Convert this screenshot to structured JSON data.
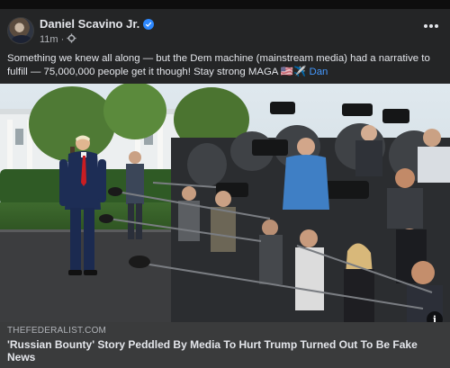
{
  "post": {
    "author": "Daniel Scavino Jr.",
    "time": "11m",
    "audience_icon": "gear-icon",
    "text": "Something we knew all along — but the Dem machine (mainstream media) had a narrative to fulfill — 75,000,000 people get it though! Stay strong MAGA 🇺🇸✈️ ",
    "signature": "Dan"
  },
  "link_preview": {
    "domain": "THEFEDERALIST.COM",
    "headline": "'Russian Bounty' Story Peddled By Media To Hurt Trump Turned Out To Be Fake News"
  },
  "colors": {
    "card": "#242526",
    "link": "#4599ff",
    "verified": "#2d88ff"
  }
}
